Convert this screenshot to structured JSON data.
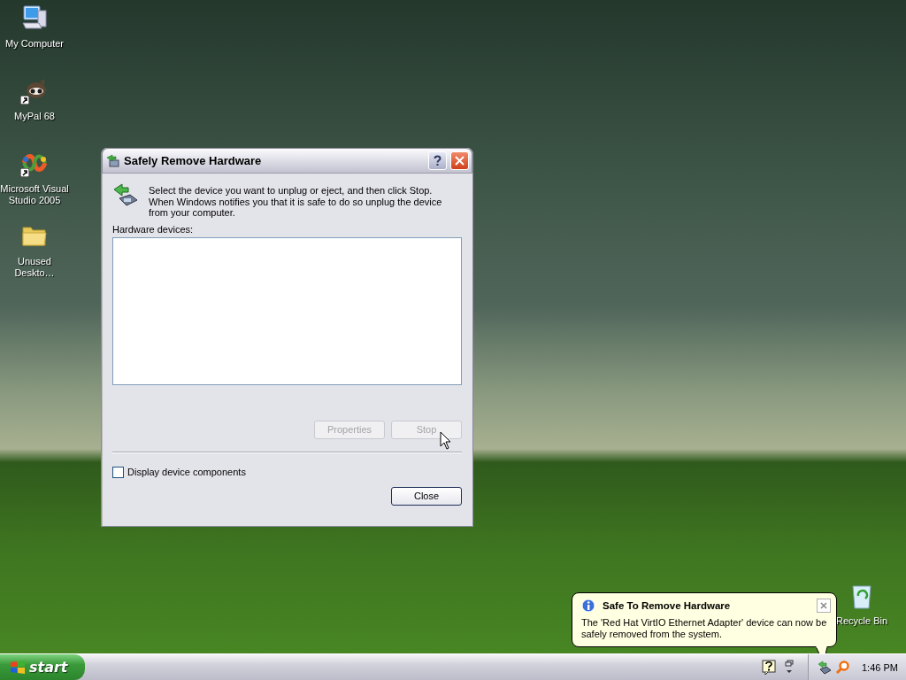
{
  "desktop_icons": [
    {
      "label": "My Computer",
      "kind": "computer",
      "shortcut": false
    },
    {
      "label": "MyPal 68",
      "kind": "raccoon",
      "shortcut": true
    },
    {
      "label": "Microsoft Visual Studio 2005",
      "kind": "studio",
      "shortcut": true
    },
    {
      "label": "Unused Deskto…",
      "kind": "folder",
      "shortcut": false
    }
  ],
  "recycle_bin": {
    "label": "Recycle Bin"
  },
  "dialog": {
    "title": "Safely Remove Hardware",
    "instructions": "Select the device you want to unplug or eject, and then click Stop. When Windows notifies you that it is safe to do so unplug the device from your computer.",
    "list_label": "Hardware devices:",
    "buttons": [
      {
        "label": "Properties",
        "disabled": true
      },
      {
        "label": "Stop",
        "disabled": true
      }
    ],
    "checkbox": {
      "label": "Display device components",
      "checked": false
    },
    "close_button": "Close"
  },
  "balloon": {
    "title": "Safe To Remove Hardware",
    "message": "The 'Red Hat VirtIO Ethernet Adapter' device can now be safely removed from the system."
  },
  "taskbar": {
    "start_label": "start",
    "clock": "1:46 PM"
  }
}
